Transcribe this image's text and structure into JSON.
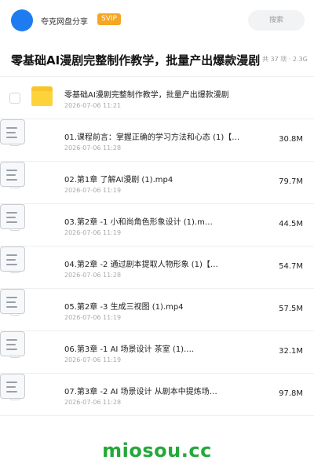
{
  "header": {
    "uploader": "夸克网盘分享",
    "badge": "SVIP",
    "search_placeholder": "搜索"
  },
  "share": {
    "title": "零基础AI漫剧完整制作教学，批量产出爆款漫剧",
    "meta": "共 37 项 · 2.3G"
  },
  "files": [
    {
      "icon": "folder-icon",
      "name": "零基础AI漫剧完整制作教学，批量产出爆款漫剧",
      "date": "2026-07-06 11:21",
      "size": ""
    },
    {
      "icon": "document-icon",
      "name": "01.课程前言：掌握正确的学习方法和心态 (1)【…",
      "date": "2026-07-06 11:28",
      "size": "30.8M"
    },
    {
      "icon": "document-icon",
      "name": "02.第1章 了解AI漫剧 (1).mp4",
      "date": "2026-07-06 11:19",
      "size": "79.7M"
    },
    {
      "icon": "document-icon",
      "name": "03.第2章 -1 小和尚角色形象设计 (1).m…",
      "date": "2026-07-06 11:19",
      "size": "44.5M"
    },
    {
      "icon": "document-icon",
      "name": "04.第2章 -2 通过剧本提取人物形象 (1)【…",
      "date": "2026-07-06 11:28",
      "size": "54.7M"
    },
    {
      "icon": "document-icon",
      "name": "05.第2章 -3 生成三视图 (1).mp4",
      "date": "2026-07-06 11:19",
      "size": "57.5M"
    },
    {
      "icon": "document-icon",
      "name": "06.第3章 -1 AI 场景设计 茶室 (1).…",
      "date": "2026-07-06 11:19",
      "size": "32.1M"
    },
    {
      "icon": "document-icon",
      "name": "07.第3章 -2 AI 场景设计 从剧本中提炼场…",
      "date": "2026-07-06 11:28",
      "size": "97.8M"
    }
  ],
  "watermark": "miosou.cc",
  "colors": {
    "accent": "#1f7cf0",
    "svip": "#f5a623",
    "folder": "#fdd33a",
    "watermark": "#25a83a"
  }
}
